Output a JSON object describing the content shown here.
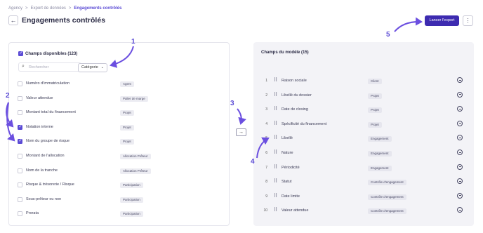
{
  "breadcrumb": {
    "items": [
      "Agency",
      ">",
      "Export de données",
      ">"
    ],
    "current": "Engagements contrôlés"
  },
  "header": {
    "title": "Engagements contrôlés",
    "back_icon": "arrow-left-icon",
    "export_label": "Lancer l'export",
    "more_icon": "kebab-menu-icon"
  },
  "colors": {
    "accent": "#5b4bd5",
    "primary_button": "#3d2bb0",
    "panel_bg": "#f3f3f7"
  },
  "available": {
    "title": "Champs disponibles (123)",
    "search_placeholder": "Rechercher",
    "category_label": "Catégorie",
    "fields": [
      {
        "label": "Numéro d'immatriculation",
        "tag": "Agent",
        "checked": false
      },
      {
        "label": "Valeur attendue",
        "tag": "Palier de marge",
        "checked": false
      },
      {
        "label": "Montant total du financement",
        "tag": "Projet",
        "checked": false
      },
      {
        "label": "Notation interne",
        "tag": "Projet",
        "checked": true
      },
      {
        "label": "Nom du groupe de risque",
        "tag": "Projet",
        "checked": true
      },
      {
        "label": "Montant de l'allocation",
        "tag": "Allocation Prêteur",
        "checked": false
      },
      {
        "label": "Nom de la tranche",
        "tag": "Allocation Prêteur",
        "checked": false
      },
      {
        "label": "Risque & trésorerie / Risque",
        "tag": "Participation",
        "checked": false
      },
      {
        "label": "Sous-prêteur ou non",
        "tag": "Participation",
        "checked": false
      },
      {
        "label": "Prorata",
        "tag": "Participation",
        "checked": false
      }
    ]
  },
  "move_icon": "arrow-right-icon",
  "model": {
    "title": "Champs du modèle (15)",
    "fields": [
      {
        "num": "1",
        "label": "Raison sociale",
        "tag": "Client"
      },
      {
        "num": "2",
        "label": "Libellé du dossier",
        "tag": "Projet"
      },
      {
        "num": "3",
        "label": "Date de closing",
        "tag": "Projet"
      },
      {
        "num": "4",
        "label": "Spécificité du financement",
        "tag": "Projet"
      },
      {
        "num": "5",
        "label": "Libellé",
        "tag": "Engagement"
      },
      {
        "num": "6",
        "label": "Nature",
        "tag": "Engagement"
      },
      {
        "num": "7",
        "label": "Périodicité",
        "tag": "Engagement"
      },
      {
        "num": "8",
        "label": "Statut",
        "tag": "Contrôle d'engagement"
      },
      {
        "num": "9",
        "label": "Date limite",
        "tag": "Contrôle d'engagement"
      },
      {
        "num": "10",
        "label": "Valeur attendue",
        "tag": "Contrôle d'engagement"
      }
    ]
  },
  "annotations": [
    "1",
    "2",
    "3",
    "4",
    "5"
  ]
}
